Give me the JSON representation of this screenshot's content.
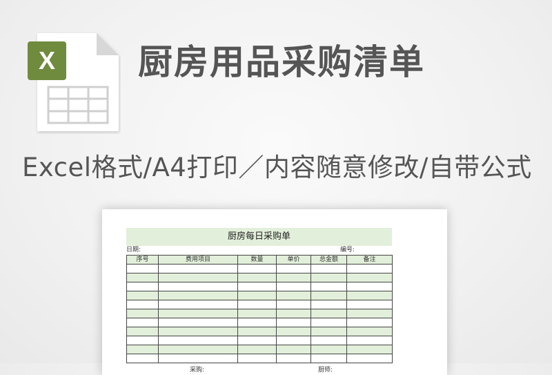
{
  "header": {
    "title": "厨房用品采购清单",
    "subtitle": "Excel格式/A4打印／内容随意修改/自带公式",
    "icon_letter": "X"
  },
  "colors": {
    "excel_badge": "#6f8b3e",
    "sheet_green": "#e2efda",
    "text_gray": "#555555"
  },
  "preview": {
    "sheet_title": "厨房每日采购单",
    "date_label": "日期:",
    "number_label": "编号:",
    "columns": [
      "序号",
      "费用项目",
      "数量",
      "单价",
      "总金额",
      "备注"
    ],
    "row_count": 11,
    "footer_left": "采购:",
    "footer_right": "厨师:"
  }
}
